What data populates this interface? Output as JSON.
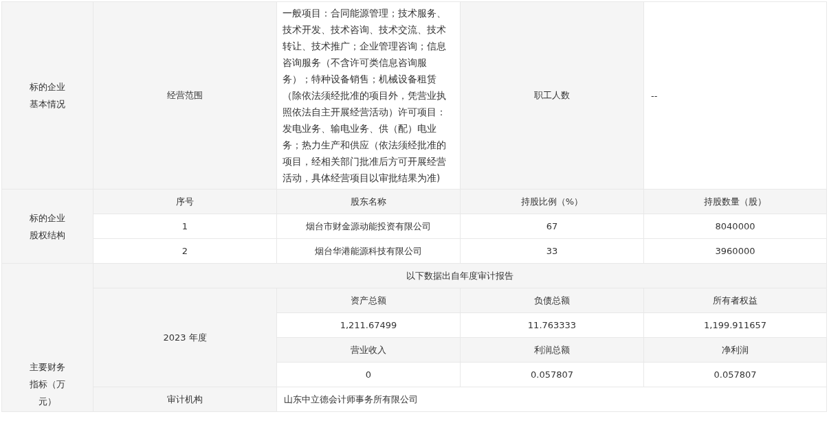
{
  "basic_info": {
    "label": "标的企业基本情况",
    "fields": [
      {
        "label": "经营范围",
        "value": "一般项目：合同能源管理；技术服务、技术开发、技术咨询、技术交流、技术转让、技术推广；企业管理咨询；信息咨询服务（不含许可类信息咨询服务）；特种设备销售；机械设备租赁（除依法须经批准的项目外，凭营业执照依法自主开展经营活动）许可项目：发电业务、输电业务、供（配）电业务；热力生产和供应（依法须经批准的项目，经相关部门批准后方可开展经营活动，具体经营项目以审批结果为准)"
      },
      {
        "label": "职工人数",
        "value": "--"
      }
    ]
  },
  "equity": {
    "label": "标的企业股权结构",
    "columns": [
      "序号",
      "股东名称",
      "持股比例（%）",
      "持股数量（股）"
    ],
    "rows": [
      [
        "1",
        "烟台市财金源动能投资有限公司",
        "67",
        "8040000"
      ],
      [
        "2",
        "烟台华港能源科技有限公司",
        "33",
        "3960000"
      ]
    ]
  },
  "financials": {
    "label": "主要财务指标（万元）",
    "note": "以下数据出自年度审计报告",
    "period": "2023 年度",
    "groups": [
      {
        "headers": [
          "资产总额",
          "负债总额",
          "所有者权益"
        ],
        "values": [
          "1,211.67499",
          "11.763333",
          "1,199.911657"
        ]
      },
      {
        "headers": [
          "营业收入",
          "利润总额",
          "净利润"
        ],
        "values": [
          "0",
          "0.057807",
          "0.057807"
        ]
      }
    ],
    "auditor_label": "审计机构",
    "auditor": "山东中立德会计师事务所有限公司"
  }
}
